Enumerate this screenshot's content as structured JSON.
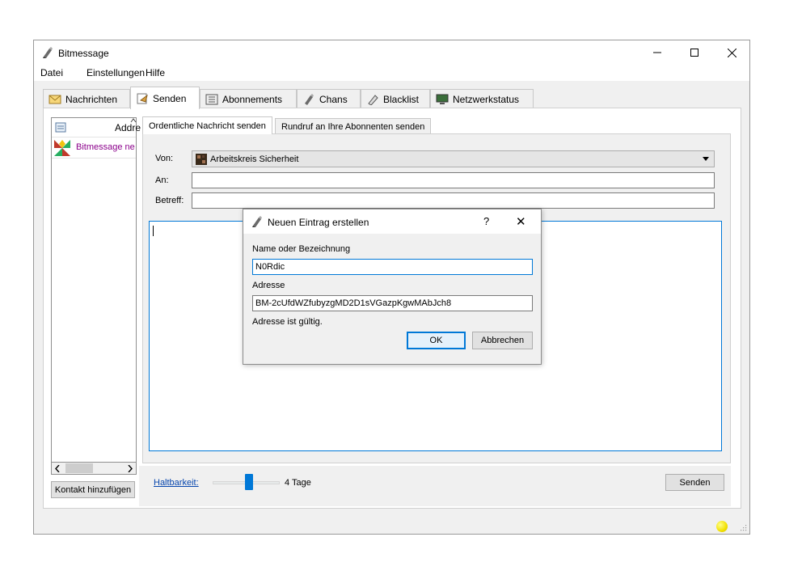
{
  "window": {
    "title": "Bitmessage"
  },
  "menu": [
    "Datei",
    "Einstellungen",
    "Hilfe"
  ],
  "tabs": [
    {
      "label": "Nachrichten",
      "icon": "inbox-icon"
    },
    {
      "label": "Senden",
      "icon": "send-icon",
      "active": true
    },
    {
      "label": "Abonnements",
      "icon": "subscriptions-icon"
    },
    {
      "label": "Chans",
      "icon": "chans-icon"
    },
    {
      "label": "Blacklist",
      "icon": "blacklist-icon"
    },
    {
      "label": "Netzwerkstatus",
      "icon": "network-status-icon"
    }
  ],
  "addressbook": {
    "header": "Addre",
    "entries": [
      "Bitmessage ne"
    ],
    "add_contact_label": "Kontakt hinzufügen"
  },
  "send": {
    "subtabs": [
      "Ordentliche Nachricht senden",
      "Rundruf an Ihre Abonnenten senden"
    ],
    "from_label": "Von:",
    "from_value": "Arbeitskreis Sicherheit",
    "to_label": "An:",
    "to_value": "",
    "subject_label": "Betreff:",
    "subject_value": "",
    "body_value": "",
    "ttl_label": "Haltbarkeit:",
    "ttl_value": "4 Tage",
    "send_label": "Senden"
  },
  "dialog": {
    "title": "Neuen Eintrag erstellen",
    "help_symbol": "?",
    "close_symbol": "✕",
    "name_label": "Name oder Bezeichnung",
    "name_value": "N0Rdic",
    "address_label": "Adresse",
    "address_value": "BM-2cUfdWZfubyzgMD2D1sVGazpKgwMAbJch8",
    "status_text": "Adresse ist gültig.",
    "ok_label": "OK",
    "cancel_label": "Abbrechen"
  },
  "colors": {
    "accent": "#0078d7",
    "address_entry_text": "#8b008b",
    "status_indicator": "#f2e000"
  }
}
